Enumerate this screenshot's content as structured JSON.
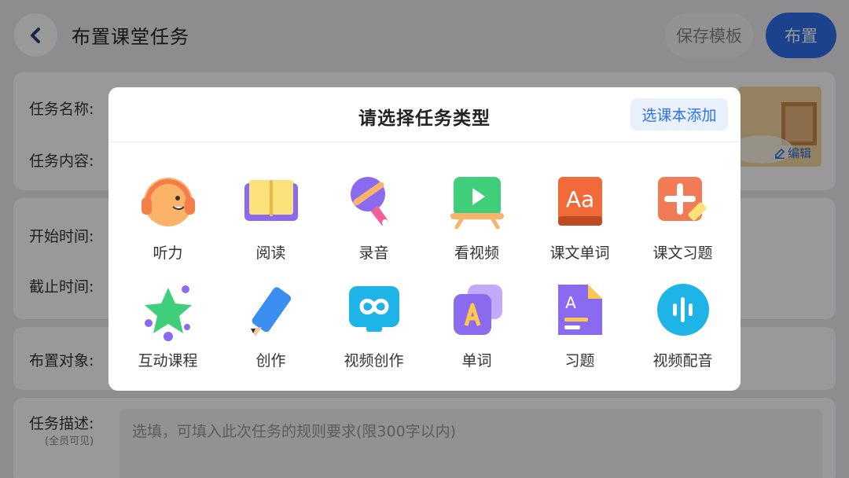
{
  "header": {
    "title": "布置课堂任务",
    "save_template_label": "保存模板",
    "publish_label": "布置"
  },
  "form": {
    "task_name_label": "任务名称:",
    "task_content_label": "任务内容:",
    "start_time_label": "开始时间:",
    "end_time_label": "截止时间:",
    "target_label": "布置对象:",
    "description_label": "任务描述:",
    "description_note": "(全员可见)",
    "description_placeholder": "选填，可填入此次任务的规则要求(限300字以内)",
    "edit_label": "编辑"
  },
  "modal": {
    "title": "请选择任务类型",
    "pick_textbook_label": "选课本添加",
    "task_types": [
      {
        "label": "听力",
        "icon": "headphones-icon"
      },
      {
        "label": "阅读",
        "icon": "open-book-icon"
      },
      {
        "label": "录音",
        "icon": "microphone-icon"
      },
      {
        "label": "看视频",
        "icon": "video-play-icon"
      },
      {
        "label": "课文单词",
        "icon": "aa-text-icon"
      },
      {
        "label": "课文习题",
        "icon": "plus-pencil-icon"
      },
      {
        "label": "互动课程",
        "icon": "star-icon"
      },
      {
        "label": "创作",
        "icon": "pencil-icon"
      },
      {
        "label": "视频创作",
        "icon": "infinity-screen-icon"
      },
      {
        "label": "单词",
        "icon": "letter-a-icon"
      },
      {
        "label": "习题",
        "icon": "document-a-icon"
      },
      {
        "label": "视频配音",
        "icon": "voice-wave-icon"
      }
    ]
  },
  "colors": {
    "accent": "#2f6fea",
    "overlay": "rgba(0,0,0,0.40)"
  }
}
